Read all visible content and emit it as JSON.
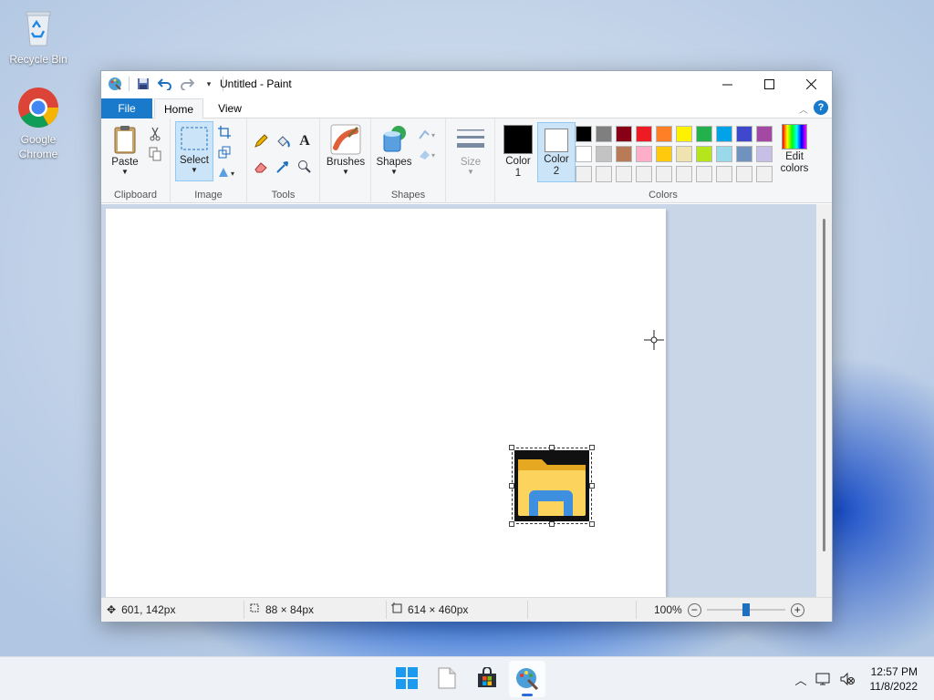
{
  "desktop": {
    "icons": [
      {
        "label": "Recycle Bin",
        "icon": "recycle-bin-icon"
      },
      {
        "label": "Google Chrome",
        "icon": "chrome-icon"
      }
    ]
  },
  "window": {
    "title": "Untitled - Paint",
    "tabs": {
      "file": "File",
      "home": "Home",
      "view": "View"
    },
    "help": "?"
  },
  "ribbon": {
    "clipboard": {
      "label": "Clipboard",
      "paste": "Paste"
    },
    "image": {
      "label": "Image",
      "select": "Select"
    },
    "tools": {
      "label": "Tools"
    },
    "brushes": {
      "label": "Brushes"
    },
    "shapes": {
      "label": "Shapes",
      "shapes_button": "Shapes"
    },
    "size": {
      "label": "Size"
    },
    "colors": {
      "label": "Colors",
      "color1_line1": "Color",
      "color1_line2": "1",
      "color2_line1": "Color",
      "color2_line2": "2",
      "edit_line1": "Edit",
      "edit_line2": "colors",
      "color1_value": "#000000",
      "color2_value": "#ffffff",
      "palette_row1": [
        "#000000",
        "#7f7f7f",
        "#880015",
        "#ed1c24",
        "#ff7f27",
        "#fff200",
        "#22b14c",
        "#00a2e8",
        "#3f48cc",
        "#a349a4"
      ],
      "palette_row2": [
        "#ffffff",
        "#c3c3c3",
        "#b97a57",
        "#ffaec9",
        "#ffc90e",
        "#efe4b0",
        "#b5e61d",
        "#99d9ea",
        "#7092be",
        "#c8bfe7"
      ],
      "palette_row3": [
        "#f0f0f0",
        "#f0f0f0",
        "#f0f0f0",
        "#f0f0f0",
        "#f0f0f0",
        "#f0f0f0",
        "#f0f0f0",
        "#f0f0f0",
        "#f0f0f0",
        "#f0f0f0"
      ]
    }
  },
  "status": {
    "cursor_pos": "601, 142px",
    "selection_size": "88 × 84px",
    "canvas_size": "614 × 460px",
    "zoom": "100%"
  },
  "taskbar": {
    "apps": [
      "windows-start-icon",
      "notepad-icon",
      "microsoft-store-icon",
      "paint-icon"
    ],
    "time": "12:57 PM",
    "date": "11/8/2022"
  }
}
